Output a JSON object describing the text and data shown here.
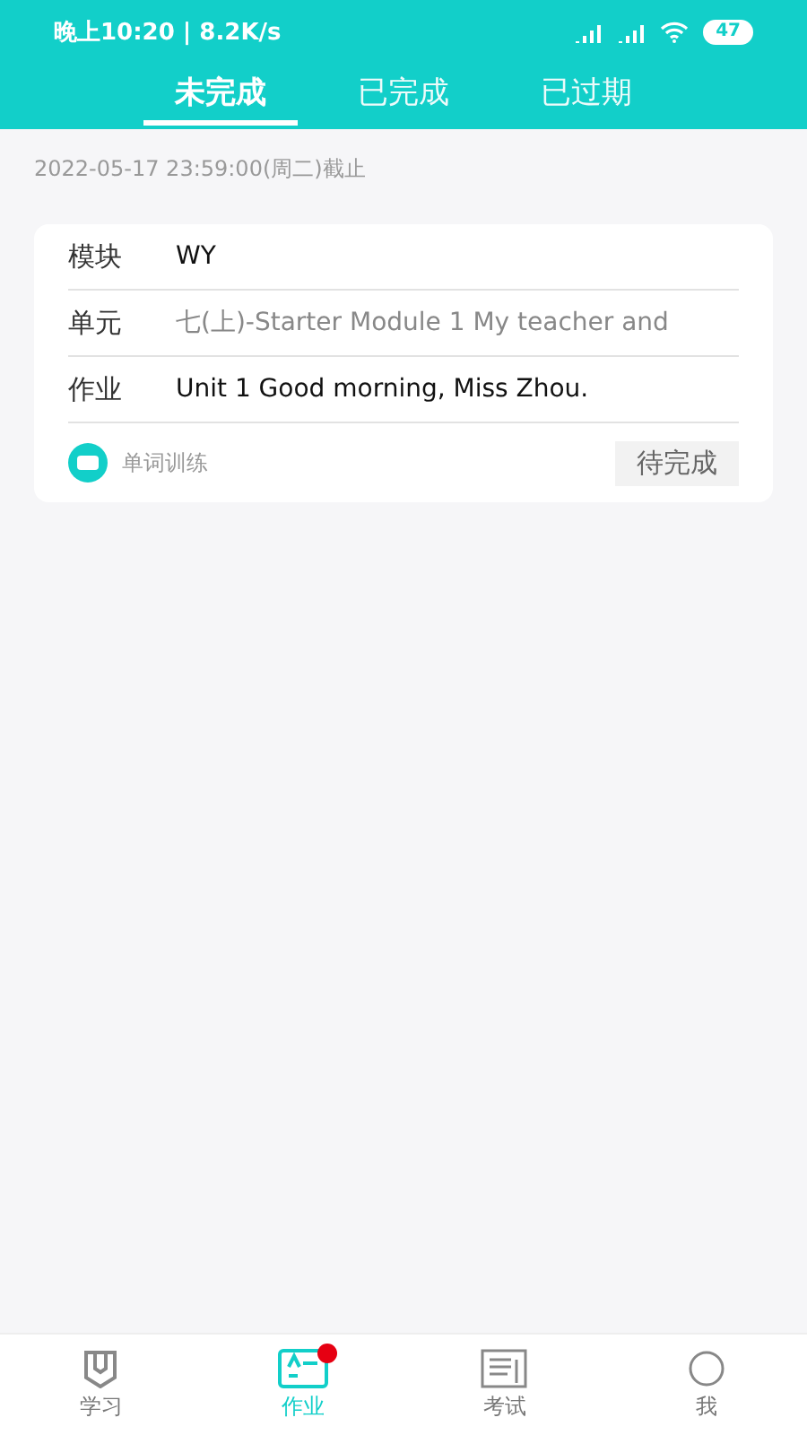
{
  "status_bar": {
    "time": "晚上10:20 | 8.2K/s",
    "battery": "47"
  },
  "tabs": [
    {
      "label": "未完成",
      "selected": true
    },
    {
      "label": "已完成",
      "selected": false
    },
    {
      "label": "已过期",
      "selected": false
    }
  ],
  "deadline": "2022-05-17 23:59:00(周二)截止",
  "card": {
    "rows": [
      {
        "label": "模块",
        "value": "WY",
        "muted": false
      },
      {
        "label": "单元",
        "value": "七(上)-Starter Module 1  My teacher and",
        "muted": true
      },
      {
        "label": "作业",
        "value": "Unit 1 Good morning, Miss Zhou.",
        "muted": false
      }
    ],
    "type": "单词训练",
    "status": "待完成"
  },
  "nav": [
    {
      "kind": "study",
      "label": "学习",
      "selected": false,
      "badge": false
    },
    {
      "kind": "homework",
      "label": "作业",
      "selected": true,
      "badge": true
    },
    {
      "kind": "exam",
      "label": "考试",
      "selected": false,
      "badge": false
    },
    {
      "kind": "me",
      "label": "我",
      "selected": false,
      "badge": false
    }
  ]
}
